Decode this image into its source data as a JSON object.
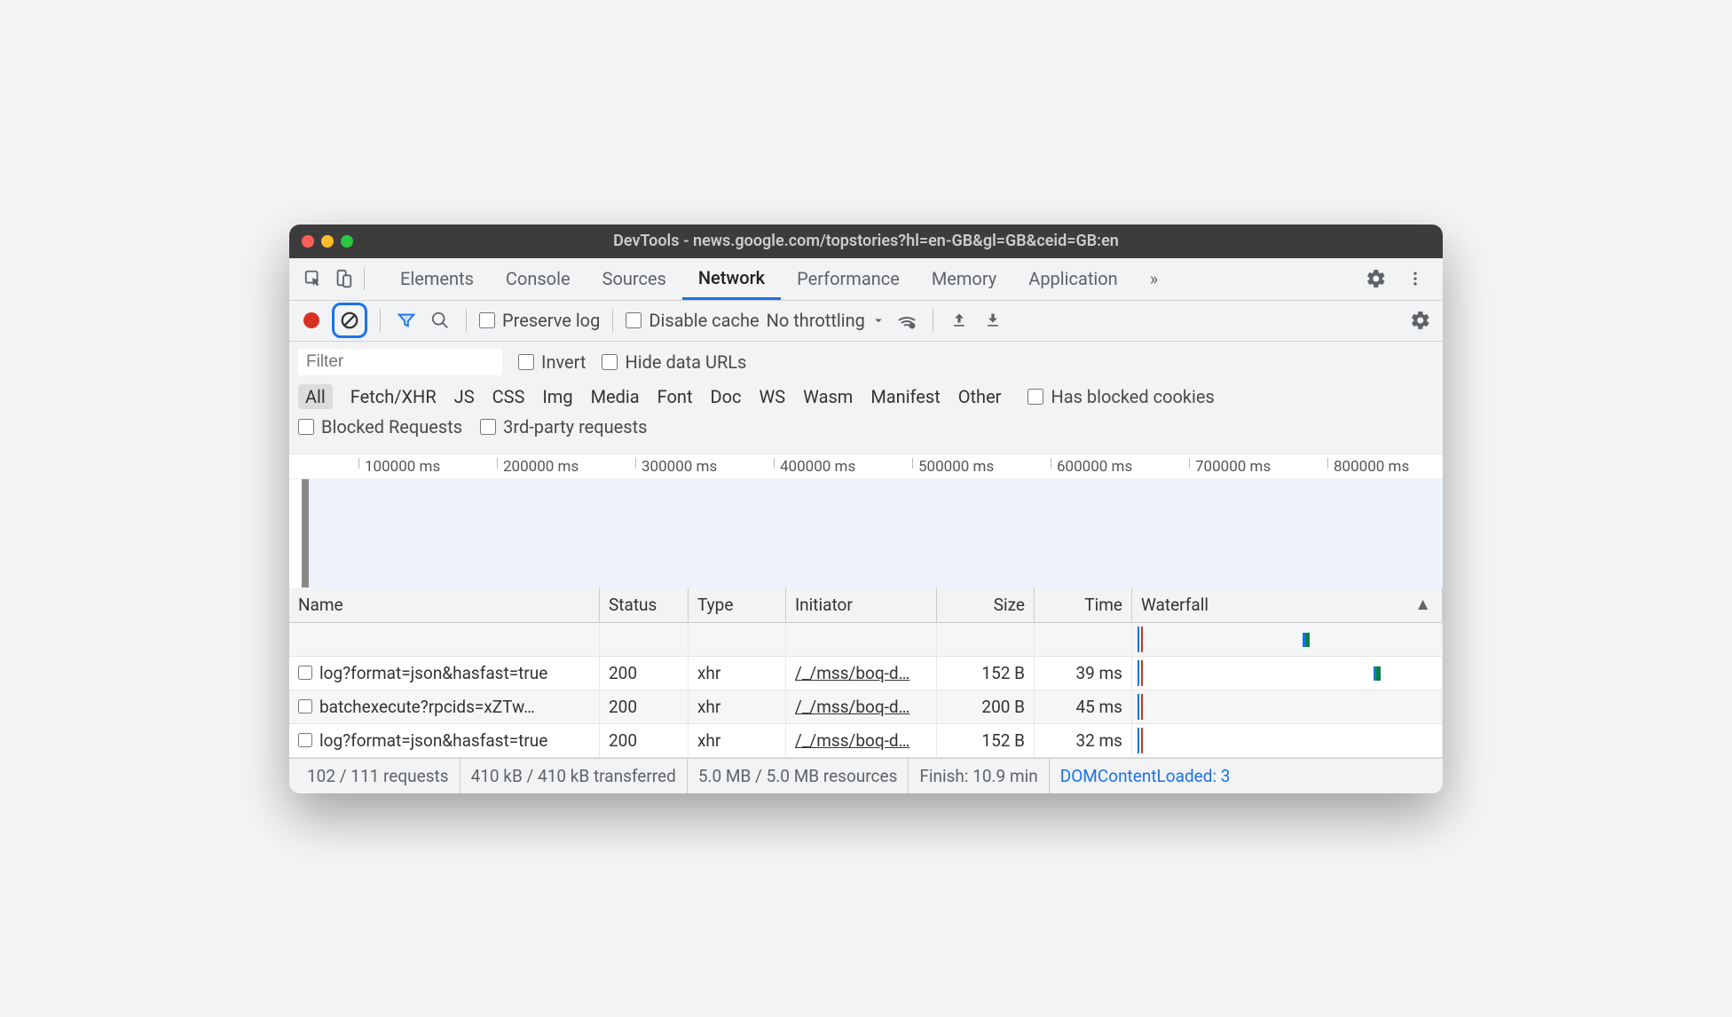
{
  "window": {
    "title": "DevTools - news.google.com/topstories?hl=en-GB&gl=GB&ceid=GB:en"
  },
  "tabs": {
    "items": [
      "Elements",
      "Console",
      "Sources",
      "Network",
      "Performance",
      "Memory",
      "Application"
    ],
    "active": "Network",
    "more_glyph": "»"
  },
  "netbar": {
    "preserve_log": "Preserve log",
    "disable_cache": "Disable cache",
    "throttling": "No throttling"
  },
  "filter": {
    "placeholder": "Filter",
    "invert": "Invert",
    "hide_data_urls": "Hide data URLs",
    "types": [
      "All",
      "Fetch/XHR",
      "JS",
      "CSS",
      "Img",
      "Media",
      "Font",
      "Doc",
      "WS",
      "Wasm",
      "Manifest",
      "Other"
    ],
    "type_active": "All",
    "has_blocked_cookies": "Has blocked cookies",
    "blocked_requests": "Blocked Requests",
    "third_party": "3rd-party requests"
  },
  "timeline": {
    "ticks": [
      "100000 ms",
      "200000 ms",
      "300000 ms",
      "400000 ms",
      "500000 ms",
      "600000 ms",
      "700000 ms",
      "800000 ms"
    ]
  },
  "columns": {
    "name": "Name",
    "status": "Status",
    "type": "Type",
    "initiator": "Initiator",
    "size": "Size",
    "time": "Time",
    "waterfall": "Waterfall"
  },
  "rows": [
    {
      "name": "log?format=json&hasfast=true",
      "status": "200",
      "type": "xhr",
      "initiator": "/_/mss/boq-d…",
      "size": "152 B",
      "time": "39 ms"
    },
    {
      "name": "batchexecute?rpcids=xZTw…",
      "status": "200",
      "type": "xhr",
      "initiator": "/_/mss/boq-d…",
      "size": "200 B",
      "time": "45 ms"
    },
    {
      "name": "log?format=json&hasfast=true",
      "status": "200",
      "type": "xhr",
      "initiator": "/_/mss/boq-d…",
      "size": "152 B",
      "time": "32 ms"
    }
  ],
  "status": {
    "requests": "102 / 111 requests",
    "transferred": "410 kB / 410 kB transferred",
    "resources": "5.0 MB / 5.0 MB resources",
    "finish": "Finish: 10.9 min",
    "dcl": "DOMContentLoaded: 3"
  }
}
